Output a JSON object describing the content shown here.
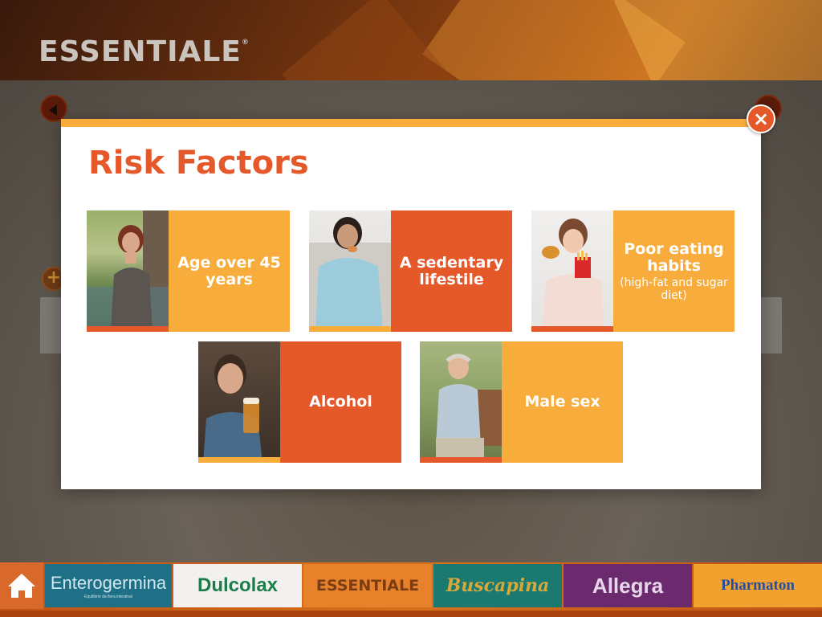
{
  "header": {
    "brand": "ESSENTIALE",
    "brand_mark": "®"
  },
  "modal": {
    "title": "Risk Factors",
    "close_icon": "×",
    "cards": [
      {
        "label": "Age over 45 years",
        "sub": ""
      },
      {
        "label": "A sedentary lifestile",
        "sub": ""
      },
      {
        "label": "Poor eating habits",
        "sub": "(high-fat and sugar diet)"
      },
      {
        "label": "Alcohol",
        "sub": ""
      },
      {
        "label": "Male sex",
        "sub": ""
      }
    ]
  },
  "background": {
    "plus_icon": "+"
  },
  "bottom_nav": {
    "home_icon": "home-icon",
    "tabs": [
      {
        "label": "Enterogermina",
        "tagline": "Equilibrio da flora intestinal"
      },
      {
        "label": "Dulcolax"
      },
      {
        "label": "ESSENTIALE"
      },
      {
        "label": "Buscapina"
      },
      {
        "label": "Allegra"
      },
      {
        "label": "Pharmaton"
      }
    ]
  },
  "colors": {
    "accent_orange": "#e4582a",
    "accent_yellow": "#f7ac3c"
  }
}
